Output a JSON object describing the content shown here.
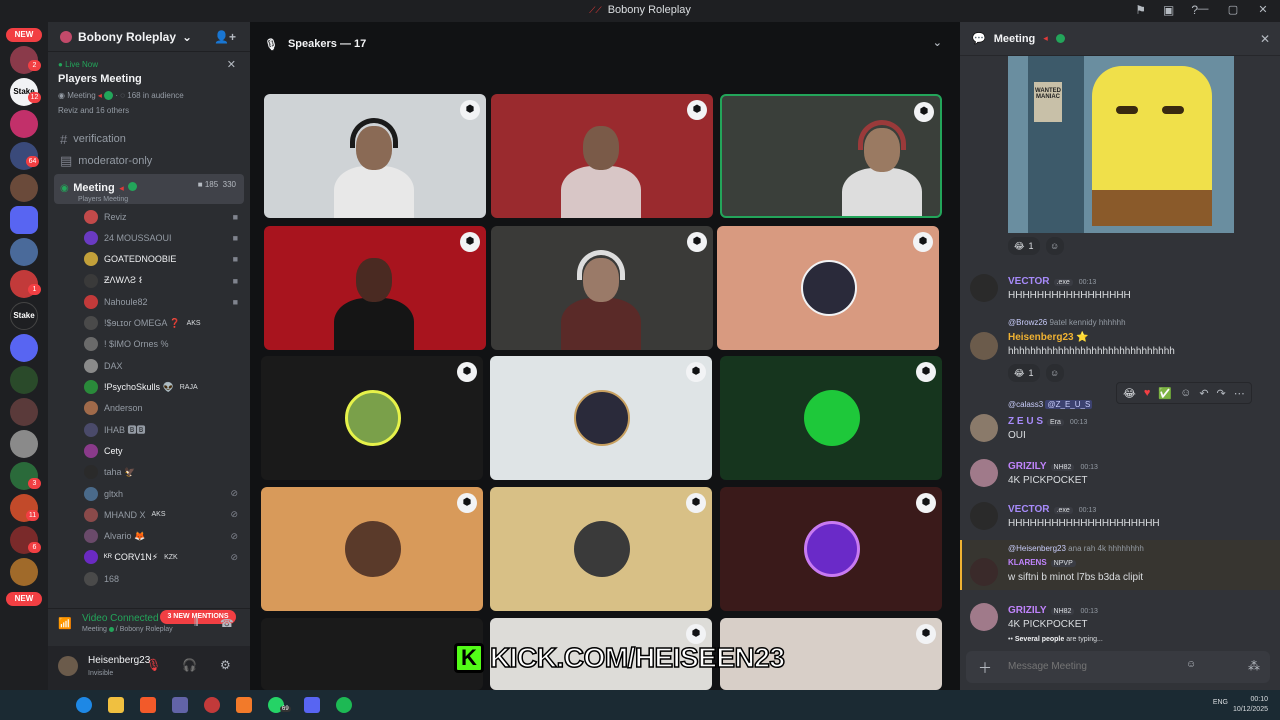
{
  "window": {
    "title": "Bobony Roleplay",
    "controls": [
      "—",
      "▢",
      "✕"
    ],
    "tools": [
      "⚑",
      "▣",
      "?"
    ]
  },
  "rail": {
    "new_top": "NEW",
    "new_bottom": "NEW",
    "badges": [
      "2",
      "12",
      "64",
      "1",
      "3",
      "11",
      "6"
    ],
    "stake": "Stake"
  },
  "sidebar": {
    "server_name": "Bobony Roleplay",
    "chevron": "⌄",
    "add_icon": "👤+",
    "live": {
      "status": "Live Now",
      "title": "Players Meeting",
      "meta_channel": "Meeting",
      "audience": "168 in audience",
      "others": "Reviz and 16 others",
      "close": "✕"
    },
    "channels": [
      {
        "label": "verification",
        "icon": "#"
      },
      {
        "label": "moderator-only",
        "icon": "▤"
      }
    ],
    "active_channel": {
      "label": "Meeting",
      "sub": "Players Meeting",
      "cam_count": "185",
      "listen_count": "330"
    },
    "users": [
      {
        "name": "Reviz",
        "color": "#949ba4",
        "tag": ""
      },
      {
        "name": "24 MOUSSAOUI",
        "color": "#949ba4",
        "tag": ""
      },
      {
        "name": "GOATEDNOOBIE",
        "color": "#f2f3f5",
        "tag": ""
      },
      {
        "name": "ƵΛWΛƧ 𐌔",
        "color": "#f2f3f5",
        "tag": ""
      },
      {
        "name": "Nahoule82",
        "color": "#949ba4",
        "tag": ""
      },
      {
        "name": "!$ɘʟɪoɾ OMEGA ❓",
        "color": "#949ba4",
        "tag": "AKS"
      },
      {
        "name": "! $IMO Ornes %",
        "color": "#949ba4",
        "tag": ""
      },
      {
        "name": "DAX",
        "color": "#949ba4",
        "tag": ""
      },
      {
        "name": "!PsychoSkulls 👽",
        "color": "#f2f3f5",
        "tag": "RAJA"
      },
      {
        "name": "Anderson",
        "color": "#949ba4",
        "tag": ""
      },
      {
        "name": "IHAB 🅱🅱",
        "color": "#949ba4",
        "tag": ""
      },
      {
        "name": "Cety",
        "color": "#f2f3f5",
        "tag": ""
      },
      {
        "name": "taha 🦅",
        "color": "#949ba4",
        "tag": ""
      },
      {
        "name": "gltxh",
        "color": "#949ba4",
        "tag": ""
      },
      {
        "name": "MHAND X",
        "color": "#949ba4",
        "tag": "AKS"
      },
      {
        "name": "Alvario 🦊",
        "color": "#949ba4",
        "tag": ""
      },
      {
        "name": "ᴷᴿ CORV1N⚡",
        "color": "#f2f3f5",
        "tag": "KZK"
      },
      {
        "name": "168",
        "color": "#949ba4",
        "tag": ""
      }
    ],
    "new_mentions": "3 NEW MENTIONS",
    "voice": {
      "status": "Video Connected",
      "channel": "Meeting",
      "server": "Bobony Roleplay"
    },
    "me": {
      "name": "Heisenberg23",
      "status": "Invisible"
    }
  },
  "stage": {
    "header": "Speakers — 17",
    "kick_letter": "K",
    "kick_url": "KICK.COM/HEISEEN23"
  },
  "chat": {
    "title": "Meeting",
    "gif_sign": "WANTED MANIAC",
    "reaction_counts": [
      "1",
      "1"
    ],
    "messages": [
      {
        "user": "VECTOR",
        "badge": ".exe",
        "time": "00:13",
        "text": "HHHHHHHHHHHHHHHHH",
        "color": "#a78bfa"
      },
      {
        "reply_user": "@Browz26",
        "reply_text": "9atel kennidy hhhhhh",
        "user": "Heisenberg23",
        "badge": "⭐",
        "time": "",
        "text": "hhhhhhhhhhhhhhhhhhhhhhhhhhhhhh",
        "color": "#f0b232"
      },
      {
        "reply_user": "@calass3",
        "reply_text": "@Z_E_U_S",
        "user": "Z E U S",
        "badge": "Era",
        "time": "00:13",
        "text": "OUI",
        "color": "#a78bfa"
      },
      {
        "user": "GRIZILY",
        "badge": "NH82",
        "time": "00:13",
        "text": "4K PICKPOCKET",
        "color": "#c084fc"
      },
      {
        "user": "VECTOR",
        "badge": ".exe",
        "time": "00:13",
        "text": "HHHHHHHHHHHHHHHHHHHHH",
        "color": "#a78bfa"
      },
      {
        "reply_user": "@Heisenberg23",
        "reply_text": "ana rah 4k hhhhhhhh",
        "user": "KLARENS",
        "badge": "NPVP",
        "time": "",
        "text": "w siftni b minot l7bs  b3da clipit",
        "color": "#c084fc"
      },
      {
        "user": "GRIZILY",
        "badge": "NH82",
        "time": "00:13",
        "text": "4K PICKPOCKET",
        "color": "#c084fc"
      }
    ],
    "typing_who": "Several people",
    "typing_rest": "are typing...",
    "composer_placeholder": "Message Meeting"
  },
  "taskbar": {
    "clock_time": "00:10",
    "clock_date": "10/12/2025",
    "tray": "ENG",
    "badge": "69"
  }
}
